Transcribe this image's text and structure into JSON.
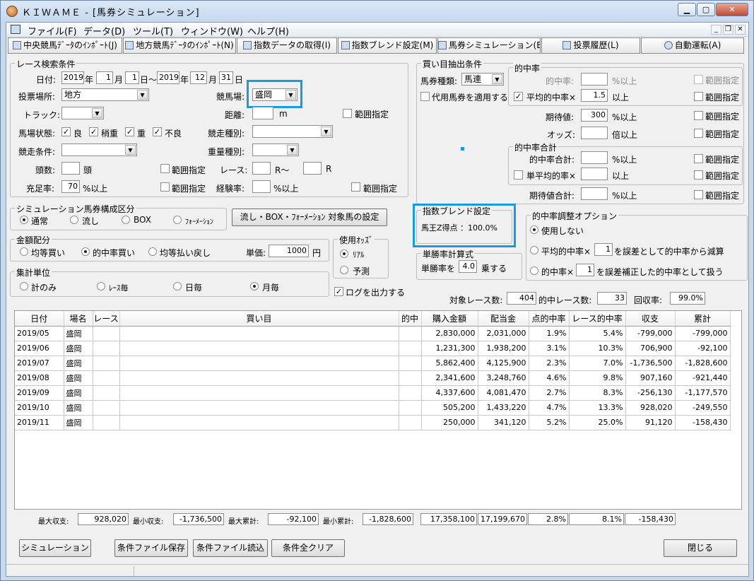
{
  "window": {
    "title": "ＫＩＷＡＭＥ - [馬券シミュレーション]"
  },
  "menu": [
    {
      "label": "ファイル(F)"
    },
    {
      "label": "データ(D)"
    },
    {
      "label": "ツール(T)"
    },
    {
      "label": "ウィンドウ(W)"
    },
    {
      "label": "ヘルプ(H)"
    }
  ],
  "toolbar": [
    {
      "label": "中央競馬ﾃﾞｰﾀのｲﾝﾎﾟｰﾄ(J)"
    },
    {
      "label": "地方競馬ﾃﾞｰﾀのｲﾝﾎﾟｰﾄ(N)"
    },
    {
      "label": "指数データの取得(I)"
    },
    {
      "label": "指数ブレンド設定(M)"
    },
    {
      "label": "馬券シミュレーション(B)"
    },
    {
      "label": "投票履歴(L)"
    },
    {
      "label": "自動運転(A)"
    }
  ],
  "search": {
    "title": "レース検索条件",
    "date_label": "日付:",
    "from_year": "2019",
    "year_unit": "年",
    "from_month": "1",
    "month_unit": "月",
    "from_day": "1",
    "day_tilde": "日〜",
    "to_year": "2019",
    "to_month": "12",
    "to_day": "31",
    "day_unit": "日",
    "venue_label": "投票場所:",
    "venue_value": "地方",
    "course_label": "競馬場:",
    "course_value": "盛岡",
    "track_label": "トラック:",
    "track_value": "",
    "distance_label": "距離:",
    "distance_value": "",
    "distance_unit": "m",
    "distance_range": "範囲指定",
    "baba_label": "馬場状態:",
    "baba_items": [
      "良",
      "稍重",
      "重",
      "不良"
    ],
    "race_type_label": "競走種別:",
    "race_type_value": "",
    "race_cond_label": "競走条件:",
    "race_cond_value": "",
    "weight_label": "重量種別:",
    "weight_value": "",
    "heads_label": "頭数:",
    "heads_value": "",
    "heads_unit": "頭",
    "heads_range": "範囲指定",
    "race_label": "レース:",
    "race_from": "",
    "race_r1": "R〜",
    "race_to": "",
    "race_r2": "R",
    "fill_label": "充足率:",
    "fill_value": "70",
    "fill_unit": "%以上",
    "fill_range": "範囲指定",
    "exp_label": "経験率:",
    "exp_value": "",
    "exp_unit": "%以上",
    "exp_range": "範囲指定"
  },
  "sim_group": {
    "title": "シミュレーション馬券構成区分",
    "options": [
      "通常",
      "流し",
      "BOX",
      "ﾌｫｰﾒｰｼｮﾝ"
    ],
    "selected": 0,
    "button": "流し・BOX・ﾌｫｰﾒｰｼｮﾝ 対象馬の設定"
  },
  "money": {
    "title": "金額配分",
    "options": [
      "均等買い",
      "的中率買い",
      "均等払い戻し"
    ],
    "selected": 1,
    "unit_label": "単価:",
    "unit_value": "1000",
    "unit_yen": "円"
  },
  "odds": {
    "title": "使用ｵｯｽﾞ",
    "options": [
      "ﾘｱﾙ",
      "予測"
    ],
    "selected": 0
  },
  "agg": {
    "title": "集計単位",
    "options": [
      "計のみ",
      "ﾚｰｽ毎",
      "日毎",
      "月毎"
    ],
    "selected": 3
  },
  "log_label": "ログを出力する",
  "buy": {
    "title": "買い目抽出条件",
    "kind_label": "馬券種類:",
    "kind_value": "馬連",
    "substitute": "代用馬券を適用する",
    "hit_title": "的中率",
    "hit_label": "的中率:",
    "hit_value": "",
    "hit_unit": "%以上",
    "hit_range": "範囲指定",
    "avg_label": "平均的中率×",
    "avg_value": "1.5",
    "avg_unit": "以上",
    "avg_range": "範囲指定",
    "exp_label": "期待値:",
    "exp_value": "300",
    "exp_unit": "%以上",
    "exp_range": "範囲指定",
    "odds_label": "オッズ:",
    "odds_value": "",
    "odds_unit": "倍以上",
    "odds_range": "範囲指定",
    "sum_title": "的中率合計",
    "sum_label": "的中率合計:",
    "sum_value": "",
    "sum_unit": "%以上",
    "sum_range": "範囲指定",
    "single_label": "単平均的率×",
    "single_value": "",
    "single_unit": "以上",
    "single_range": "範囲指定",
    "expsum_label": "期待値合計:",
    "expsum_value": "",
    "expsum_unit": "%以上",
    "expsum_range": "範囲指定"
  },
  "blend": {
    "title": "指数ブレンド設定",
    "content": "馬王Z得点 ：100.0%"
  },
  "single_win": {
    "title": "単勝率計算式",
    "prefix": "単勝率を",
    "value": "4.0",
    "suffix": "乗する"
  },
  "adjust": {
    "title": "的中率調整オプション",
    "opt0": "使用しない",
    "opt1_pre": "平均的中率×",
    "opt1_val": "1",
    "opt1_post": "を誤差として的中率から減算",
    "opt2_pre": "的中率×",
    "opt2_val": "1",
    "opt2_post": "を誤差補正した的中率として扱う",
    "selected": 0
  },
  "counts": {
    "target_label": "対象レース数:",
    "target": "404",
    "hit_label": "的中レース数:",
    "hit": "33",
    "recovery_label": "回収率:",
    "recovery": "99.0%"
  },
  "table": {
    "headers": [
      "日付",
      "場名",
      "レース",
      "買い目",
      "的中",
      "購入金額",
      "配当金",
      "点的中率",
      "レース的中率",
      "収支",
      "累計"
    ],
    "rows": [
      [
        "2019/05",
        "盛岡",
        "",
        "",
        "",
        "2,830,000",
        "2,031,000",
        "1.9%",
        "5.4%",
        "-799,000",
        "-799,000"
      ],
      [
        "2019/06",
        "盛岡",
        "",
        "",
        "",
        "1,231,300",
        "1,938,200",
        "3.1%",
        "10.3%",
        "706,900",
        "-92,100"
      ],
      [
        "2019/07",
        "盛岡",
        "",
        "",
        "",
        "5,862,400",
        "4,125,900",
        "2.3%",
        "7.0%",
        "-1,736,500",
        "-1,828,600"
      ],
      [
        "2019/08",
        "盛岡",
        "",
        "",
        "",
        "2,341,600",
        "3,248,760",
        "4.6%",
        "9.8%",
        "907,160",
        "-921,440"
      ],
      [
        "2019/09",
        "盛岡",
        "",
        "",
        "",
        "4,337,600",
        "4,081,470",
        "2.7%",
        "8.3%",
        "-256,130",
        "-1,177,570"
      ],
      [
        "2019/10",
        "盛岡",
        "",
        "",
        "",
        "505,200",
        "1,433,220",
        "4.7%",
        "13.3%",
        "928,020",
        "-249,550"
      ],
      [
        "2019/11",
        "盛岡",
        "",
        "",
        "",
        "250,000",
        "341,120",
        "5.2%",
        "25.0%",
        "91,120",
        "-158,430"
      ]
    ]
  },
  "summary": {
    "max_income_label": "最大収支:",
    "max_income": "928,020",
    "min_income_label": "最小収支:",
    "min_income": "-1,736,500",
    "max_cum_label": "最大累計:",
    "max_cum": "-92,100",
    "min_cum_label": "最小累計:",
    "min_cum": "-1,828,600",
    "buy_total": "17,358,100",
    "pay_total": "17,199,670",
    "point_rate": "2.8%",
    "race_rate": "8.1%",
    "balance": "-158,430"
  },
  "buttons": {
    "simulate": "シミュレーション",
    "save": "条件ファイル保存",
    "load": "条件ファイル読込",
    "clear": "条件全クリア",
    "close": "閉じる"
  }
}
